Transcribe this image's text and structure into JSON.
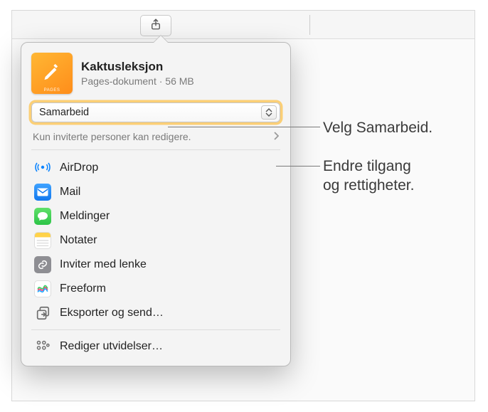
{
  "document": {
    "title": "Kaktusleksjon",
    "subtitle": "Pages-dokument · 56 MB",
    "thumb_label": "PAGES"
  },
  "collab_select": {
    "label": "Samarbeid"
  },
  "permissions": {
    "text": "Kun inviterte personer kan redigere."
  },
  "share_options": [
    {
      "id": "airdrop",
      "label": "AirDrop"
    },
    {
      "id": "mail",
      "label": "Mail"
    },
    {
      "id": "messages",
      "label": "Meldinger"
    },
    {
      "id": "notes",
      "label": "Notater"
    },
    {
      "id": "invite",
      "label": "Inviter med lenke"
    },
    {
      "id": "freeform",
      "label": "Freeform"
    },
    {
      "id": "export",
      "label": "Eksporter og send…"
    }
  ],
  "edit_extensions": {
    "label": "Rediger utvidelser…"
  },
  "callouts": {
    "collab": "Velg Samarbeid.",
    "perm_line1": "Endre tilgang",
    "perm_line2": "og rettigheter."
  }
}
